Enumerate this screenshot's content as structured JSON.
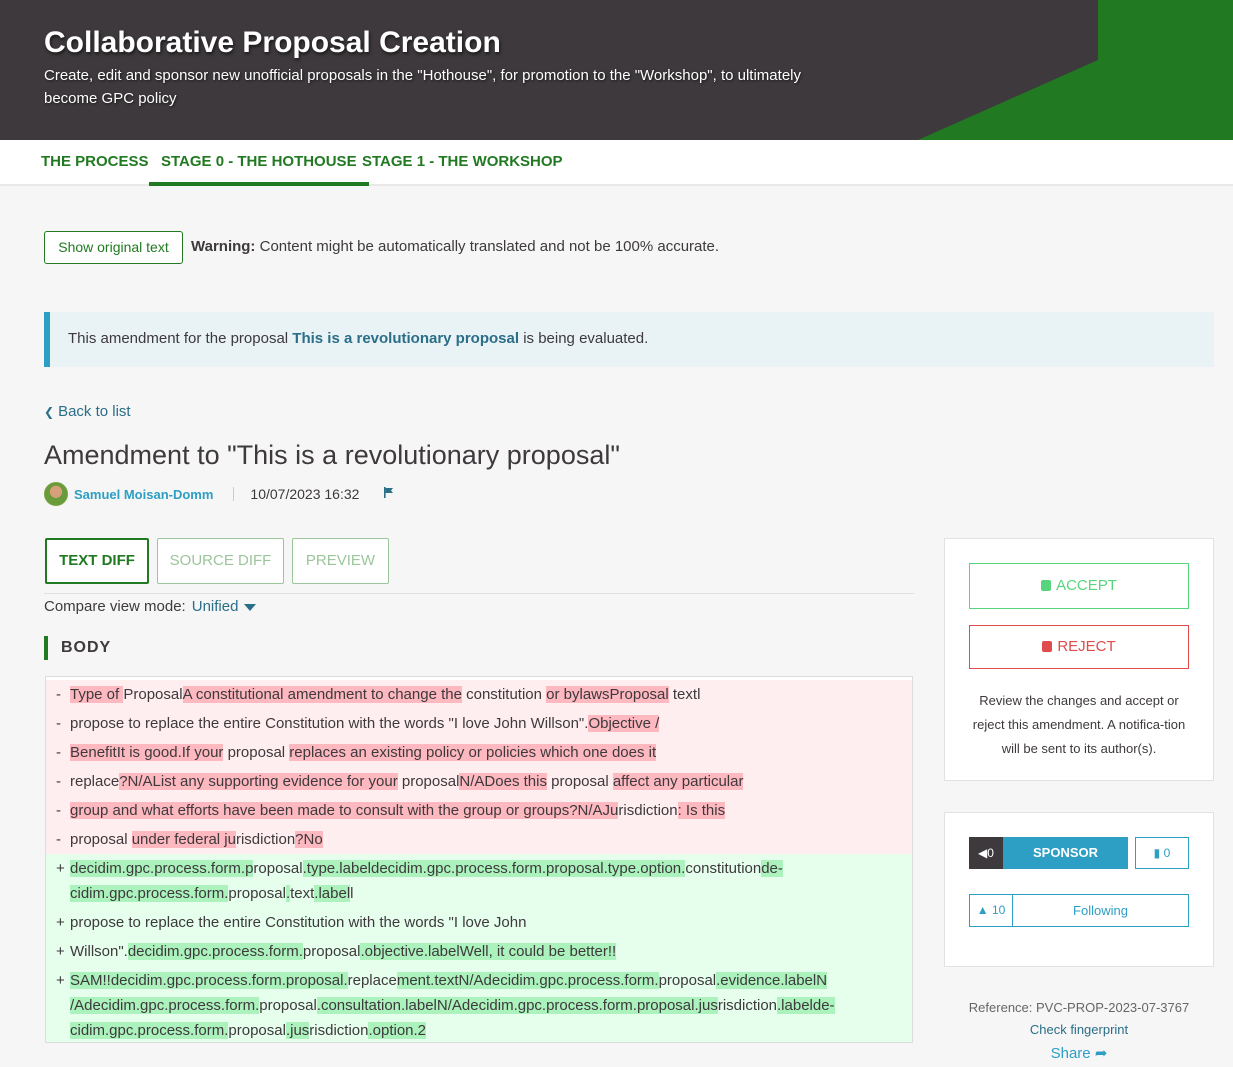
{
  "hero": {
    "title": "Collaborative Proposal Creation",
    "subtitle": "Create, edit and sponsor new unofficial proposals in the \"Hothouse\", for promotion to the \"Workshop\", to ultimately become GPC policy"
  },
  "tabs": [
    {
      "label": "The process",
      "active": false
    },
    {
      "label": "Stage 0 - The Hothouse",
      "active": true
    },
    {
      "label": "Stage 1 - The Workshop",
      "active": false
    }
  ],
  "translation": {
    "button_label": "Show original text",
    "warning_bold": "Warning:",
    "warning_text": " Content might be automatically translated and not be 100% accurate."
  },
  "callout": {
    "prefix": "This amendment for the proposal ",
    "link": "This is a revolutionary proposal",
    "suffix": " is being evaluated."
  },
  "back_label": "Back to list",
  "amendment": {
    "title": "Amendment to \"This is a revolutionary proposal\"",
    "author": "Samuel Moisan-Domm",
    "date": "10/07/2023 16:32"
  },
  "diff_tabs": [
    {
      "label": "Text diff",
      "active": true
    },
    {
      "label": "Source diff",
      "active": false
    },
    {
      "label": "Preview",
      "active": false
    }
  ],
  "compare": {
    "label": "Compare view mode:",
    "value": "Unified"
  },
  "section_label": "BODY",
  "diff_rows": [
    {
      "type": "del",
      "sign": "-",
      "lines": [
        [
          [
            "h",
            "Type of "
          ],
          [
            "p",
            "Proposal"
          ],
          [
            "h",
            "A constitutional amendment to change the"
          ],
          [
            "p",
            " constitution "
          ],
          [
            "h",
            "or bylaws"
          ],
          [
            "h",
            "Proposal"
          ],
          [
            "p",
            " text"
          ],
          [
            "p",
            "l"
          ]
        ]
      ]
    },
    {
      "type": "del",
      "sign": "-",
      "lines": [
        [
          [
            "p",
            "propose to replace the entire Constitution with the words \"I love John "
          ],
          [
            "p",
            "Willson\"."
          ],
          [
            "h",
            "Objective /"
          ]
        ]
      ]
    },
    {
      "type": "del",
      "sign": "-",
      "lines": [
        [
          [
            "h",
            "BenefitIt is good.If your"
          ],
          [
            "p",
            " proposal "
          ],
          [
            "h",
            "replaces an existing policy or policies which one does it"
          ]
        ]
      ]
    },
    {
      "type": "del",
      "sign": "-",
      "lines": [
        [
          [
            "p",
            "replace"
          ],
          [
            "h",
            "?N/AList any supporting evidence for your"
          ],
          [
            "p",
            " proposal"
          ],
          [
            "h",
            "N/ADoes this"
          ],
          [
            "p",
            " proposal "
          ],
          [
            "h",
            "affect any particular"
          ]
        ]
      ]
    },
    {
      "type": "del",
      "sign": "-",
      "lines": [
        [
          [
            "h",
            "group and what efforts have been made to consult with the group or groups?N/AJu"
          ],
          [
            "p",
            "risdiction"
          ],
          [
            "h",
            ": Is this"
          ]
        ]
      ]
    },
    {
      "type": "del",
      "sign": "-",
      "lines": [
        [
          [
            "p",
            "proposal "
          ],
          [
            "h",
            "under federal ju"
          ],
          [
            "p",
            "risdiction"
          ],
          [
            "h",
            "?No"
          ]
        ]
      ]
    },
    {
      "type": "add",
      "sign": "+",
      "lines": [
        [
          [
            "h",
            "decidim.gpc.process.form.p"
          ],
          [
            "p",
            "roposal"
          ],
          [
            "h",
            ".type.labeldecidim.gpc.process.form.proposal.type.option."
          ],
          [
            "p",
            "constitution"
          ],
          [
            "h",
            "de-"
          ]
        ],
        [
          [
            "h",
            "cidim.gpc.process.form."
          ],
          [
            "p",
            "proposal"
          ],
          [
            "h",
            "."
          ],
          [
            "p",
            "text"
          ],
          [
            "h",
            ".label"
          ],
          [
            "p",
            "l"
          ]
        ]
      ]
    },
    {
      "type": "add",
      "sign": "+",
      "lines": [
        [
          [
            "p",
            "propose to replace the entire Constitution with the words \"I love John"
          ]
        ]
      ]
    },
    {
      "type": "add",
      "sign": "+",
      "lines": [
        [
          [
            "p",
            "Willson\"."
          ],
          [
            "h",
            "decidim.gpc.process.form."
          ],
          [
            "p",
            "proposal"
          ],
          [
            "h",
            ".objective.labelWell, it could be better!!"
          ]
        ]
      ]
    },
    {
      "type": "add",
      "sign": "+",
      "lines": [
        [
          [
            "h",
            "SAM!!decidim.gpc.process.form.proposal."
          ],
          [
            "p",
            "replace"
          ],
          [
            "h",
            "ment.textN/Adecidim.gpc.process.form."
          ],
          [
            "p",
            "proposal"
          ],
          [
            "h",
            ".evidence.labelN"
          ]
        ],
        [
          [
            "h",
            "/Adecidim.gpc.process.form."
          ],
          [
            "p",
            "proposal"
          ],
          [
            "h",
            ".consultation.labelN/Adecidim.gpc.process.form.proposal.jus"
          ],
          [
            "p",
            "risdiction"
          ],
          [
            "h",
            ".labelde-"
          ]
        ],
        [
          [
            "h",
            "cidim.gpc.process.form."
          ],
          [
            "p",
            "proposal"
          ],
          [
            "h",
            ".jus"
          ],
          [
            "p",
            "risdiction"
          ],
          [
            "h",
            ".option.2"
          ]
        ]
      ]
    }
  ],
  "actions": {
    "accept": "Accept",
    "reject": "Reject",
    "note": "Review the changes and accept or reject this amendment. A notifica-tion will be sent to its author(s)."
  },
  "sponsor": {
    "count": "0",
    "label": "SPONSOR",
    "comments": "0"
  },
  "follow": {
    "count": "10",
    "label": "Following"
  },
  "reference": "Reference: PVC-PROP-2023-07-3767",
  "fingerprint": "Check fingerprint",
  "share": "Share",
  "colors": {
    "brand_green": "#217a21",
    "header_dark": "#3d393c",
    "info_blue": "#2d9ec4",
    "accept": "#57d57d",
    "reject": "#e04b4b"
  }
}
